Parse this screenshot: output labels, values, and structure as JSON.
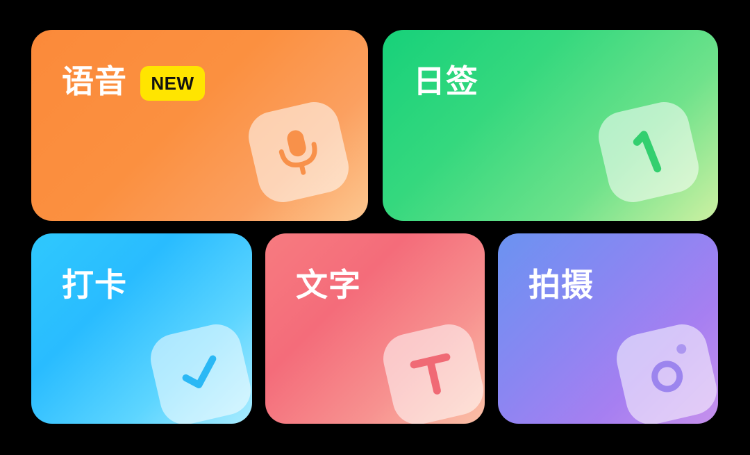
{
  "cards": {
    "voice": {
      "title": "语音",
      "badge": "NEW",
      "icon": "microphone-icon",
      "accent": "#fb8a3a"
    },
    "daily": {
      "title": "日签",
      "icon": "number-one-icon",
      "accent": "#17d17a"
    },
    "checkin": {
      "title": "打卡",
      "icon": "checkmark-icon",
      "accent": "#29bcff"
    },
    "text": {
      "title": "文字",
      "icon": "letter-t-icon",
      "accent": "#f46c7a"
    },
    "photo": {
      "title": "拍摄",
      "icon": "camera-icon",
      "accent": "#8a86f2"
    }
  },
  "colors": {
    "background": "#000000",
    "badge": "#ffe500",
    "title": "#ffffff"
  }
}
